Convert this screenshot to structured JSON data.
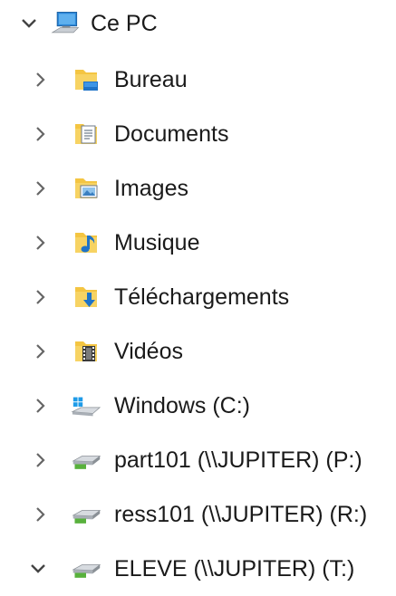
{
  "tree": {
    "root": {
      "label": "Ce PC",
      "icon": "computer-icon",
      "expanded": true
    },
    "children": [
      {
        "key": "bureau",
        "label": "Bureau",
        "icon": "desktop-folder-icon",
        "expanded": false
      },
      {
        "key": "documents",
        "label": "Documents",
        "icon": "documents-folder-icon",
        "expanded": false
      },
      {
        "key": "images",
        "label": "Images",
        "icon": "pictures-folder-icon",
        "expanded": false
      },
      {
        "key": "musique",
        "label": "Musique",
        "icon": "music-folder-icon",
        "expanded": false
      },
      {
        "key": "telechargements",
        "label": "Téléchargements",
        "icon": "downloads-folder-icon",
        "expanded": false
      },
      {
        "key": "videos",
        "label": "Vidéos",
        "icon": "videos-folder-icon",
        "expanded": false
      },
      {
        "key": "windows-c",
        "label": "Windows (C:)",
        "icon": "windows-drive-icon",
        "expanded": false
      },
      {
        "key": "part101",
        "label": "part101 (\\\\JUPITER) (P:)",
        "icon": "network-drive-icon",
        "expanded": false
      },
      {
        "key": "ress101",
        "label": "ress101 (\\\\JUPITER) (R:)",
        "icon": "network-drive-icon",
        "expanded": false
      },
      {
        "key": "eleve",
        "label": "ELEVE (\\\\JUPITER) (T:)",
        "icon": "network-drive-icon",
        "expanded": true
      }
    ]
  },
  "colors": {
    "folder": "#f4c542",
    "folder_dark": "#dca42b",
    "accent_blue": "#1e73c8",
    "chevron": "#555555",
    "drive_green": "#58b13c"
  }
}
